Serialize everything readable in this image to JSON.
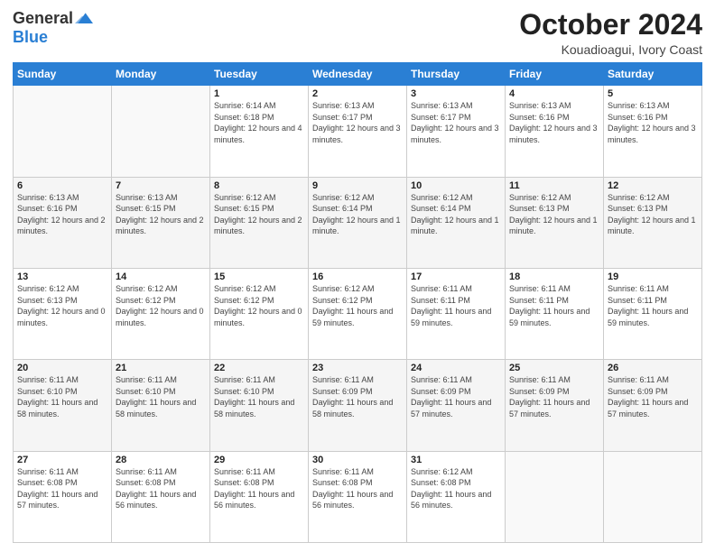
{
  "logo": {
    "general": "General",
    "blue": "Blue"
  },
  "header": {
    "month": "October 2024",
    "location": "Kouadioagui, Ivory Coast"
  },
  "days_of_week": [
    "Sunday",
    "Monday",
    "Tuesday",
    "Wednesday",
    "Thursday",
    "Friday",
    "Saturday"
  ],
  "weeks": [
    [
      {
        "day": "",
        "info": ""
      },
      {
        "day": "",
        "info": ""
      },
      {
        "day": "1",
        "info": "Sunrise: 6:14 AM\nSunset: 6:18 PM\nDaylight: 12 hours and 4 minutes."
      },
      {
        "day": "2",
        "info": "Sunrise: 6:13 AM\nSunset: 6:17 PM\nDaylight: 12 hours and 3 minutes."
      },
      {
        "day": "3",
        "info": "Sunrise: 6:13 AM\nSunset: 6:17 PM\nDaylight: 12 hours and 3 minutes."
      },
      {
        "day": "4",
        "info": "Sunrise: 6:13 AM\nSunset: 6:16 PM\nDaylight: 12 hours and 3 minutes."
      },
      {
        "day": "5",
        "info": "Sunrise: 6:13 AM\nSunset: 6:16 PM\nDaylight: 12 hours and 3 minutes."
      }
    ],
    [
      {
        "day": "6",
        "info": "Sunrise: 6:13 AM\nSunset: 6:16 PM\nDaylight: 12 hours and 2 minutes."
      },
      {
        "day": "7",
        "info": "Sunrise: 6:13 AM\nSunset: 6:15 PM\nDaylight: 12 hours and 2 minutes."
      },
      {
        "day": "8",
        "info": "Sunrise: 6:12 AM\nSunset: 6:15 PM\nDaylight: 12 hours and 2 minutes."
      },
      {
        "day": "9",
        "info": "Sunrise: 6:12 AM\nSunset: 6:14 PM\nDaylight: 12 hours and 1 minute."
      },
      {
        "day": "10",
        "info": "Sunrise: 6:12 AM\nSunset: 6:14 PM\nDaylight: 12 hours and 1 minute."
      },
      {
        "day": "11",
        "info": "Sunrise: 6:12 AM\nSunset: 6:13 PM\nDaylight: 12 hours and 1 minute."
      },
      {
        "day": "12",
        "info": "Sunrise: 6:12 AM\nSunset: 6:13 PM\nDaylight: 12 hours and 1 minute."
      }
    ],
    [
      {
        "day": "13",
        "info": "Sunrise: 6:12 AM\nSunset: 6:13 PM\nDaylight: 12 hours and 0 minutes."
      },
      {
        "day": "14",
        "info": "Sunrise: 6:12 AM\nSunset: 6:12 PM\nDaylight: 12 hours and 0 minutes."
      },
      {
        "day": "15",
        "info": "Sunrise: 6:12 AM\nSunset: 6:12 PM\nDaylight: 12 hours and 0 minutes."
      },
      {
        "day": "16",
        "info": "Sunrise: 6:12 AM\nSunset: 6:12 PM\nDaylight: 11 hours and 59 minutes."
      },
      {
        "day": "17",
        "info": "Sunrise: 6:11 AM\nSunset: 6:11 PM\nDaylight: 11 hours and 59 minutes."
      },
      {
        "day": "18",
        "info": "Sunrise: 6:11 AM\nSunset: 6:11 PM\nDaylight: 11 hours and 59 minutes."
      },
      {
        "day": "19",
        "info": "Sunrise: 6:11 AM\nSunset: 6:11 PM\nDaylight: 11 hours and 59 minutes."
      }
    ],
    [
      {
        "day": "20",
        "info": "Sunrise: 6:11 AM\nSunset: 6:10 PM\nDaylight: 11 hours and 58 minutes."
      },
      {
        "day": "21",
        "info": "Sunrise: 6:11 AM\nSunset: 6:10 PM\nDaylight: 11 hours and 58 minutes."
      },
      {
        "day": "22",
        "info": "Sunrise: 6:11 AM\nSunset: 6:10 PM\nDaylight: 11 hours and 58 minutes."
      },
      {
        "day": "23",
        "info": "Sunrise: 6:11 AM\nSunset: 6:09 PM\nDaylight: 11 hours and 58 minutes."
      },
      {
        "day": "24",
        "info": "Sunrise: 6:11 AM\nSunset: 6:09 PM\nDaylight: 11 hours and 57 minutes."
      },
      {
        "day": "25",
        "info": "Sunrise: 6:11 AM\nSunset: 6:09 PM\nDaylight: 11 hours and 57 minutes."
      },
      {
        "day": "26",
        "info": "Sunrise: 6:11 AM\nSunset: 6:09 PM\nDaylight: 11 hours and 57 minutes."
      }
    ],
    [
      {
        "day": "27",
        "info": "Sunrise: 6:11 AM\nSunset: 6:08 PM\nDaylight: 11 hours and 57 minutes."
      },
      {
        "day": "28",
        "info": "Sunrise: 6:11 AM\nSunset: 6:08 PM\nDaylight: 11 hours and 56 minutes."
      },
      {
        "day": "29",
        "info": "Sunrise: 6:11 AM\nSunset: 6:08 PM\nDaylight: 11 hours and 56 minutes."
      },
      {
        "day": "30",
        "info": "Sunrise: 6:11 AM\nSunset: 6:08 PM\nDaylight: 11 hours and 56 minutes."
      },
      {
        "day": "31",
        "info": "Sunrise: 6:12 AM\nSunset: 6:08 PM\nDaylight: 11 hours and 56 minutes."
      },
      {
        "day": "",
        "info": ""
      },
      {
        "day": "",
        "info": ""
      }
    ]
  ]
}
